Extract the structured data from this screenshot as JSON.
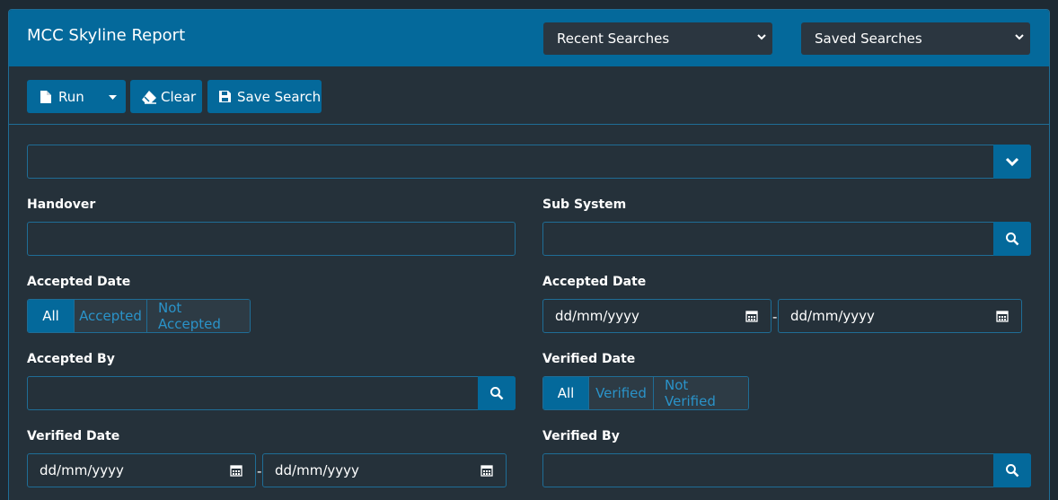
{
  "header": {
    "title": "MCC Skyline Report",
    "recent_searches": "Recent Searches",
    "saved_searches": "Saved Searches"
  },
  "toolbar": {
    "run_label": "Run",
    "clear_label": "Clear",
    "save_label": "Save Search"
  },
  "filters": {
    "handover_label": "Handover",
    "subsystem_label": "Sub System",
    "accepted_status_label": "Accepted Date",
    "accepted_options": [
      "All",
      "Accepted",
      "Not Accepted"
    ],
    "accepted_date_label": "Accepted Date",
    "accepted_date_from": "dd/mm/yyyy",
    "accepted_date_to": "dd/mm/yyyy",
    "accepted_by_label": "Accepted By",
    "verified_status_label": "Verified Date",
    "verified_options": [
      "All",
      "Verified",
      "Not Verified"
    ],
    "verified_date_label": "Verified Date",
    "verified_date_from": "dd/mm/yyyy",
    "verified_date_to": "dd/mm/yyyy",
    "verified_by_label": "Verified By",
    "range_separator": "-"
  },
  "colors": {
    "accent": "#04699b",
    "panel": "#25313a",
    "border": "#1f6d96",
    "inactive_text": "#2a93c9"
  }
}
